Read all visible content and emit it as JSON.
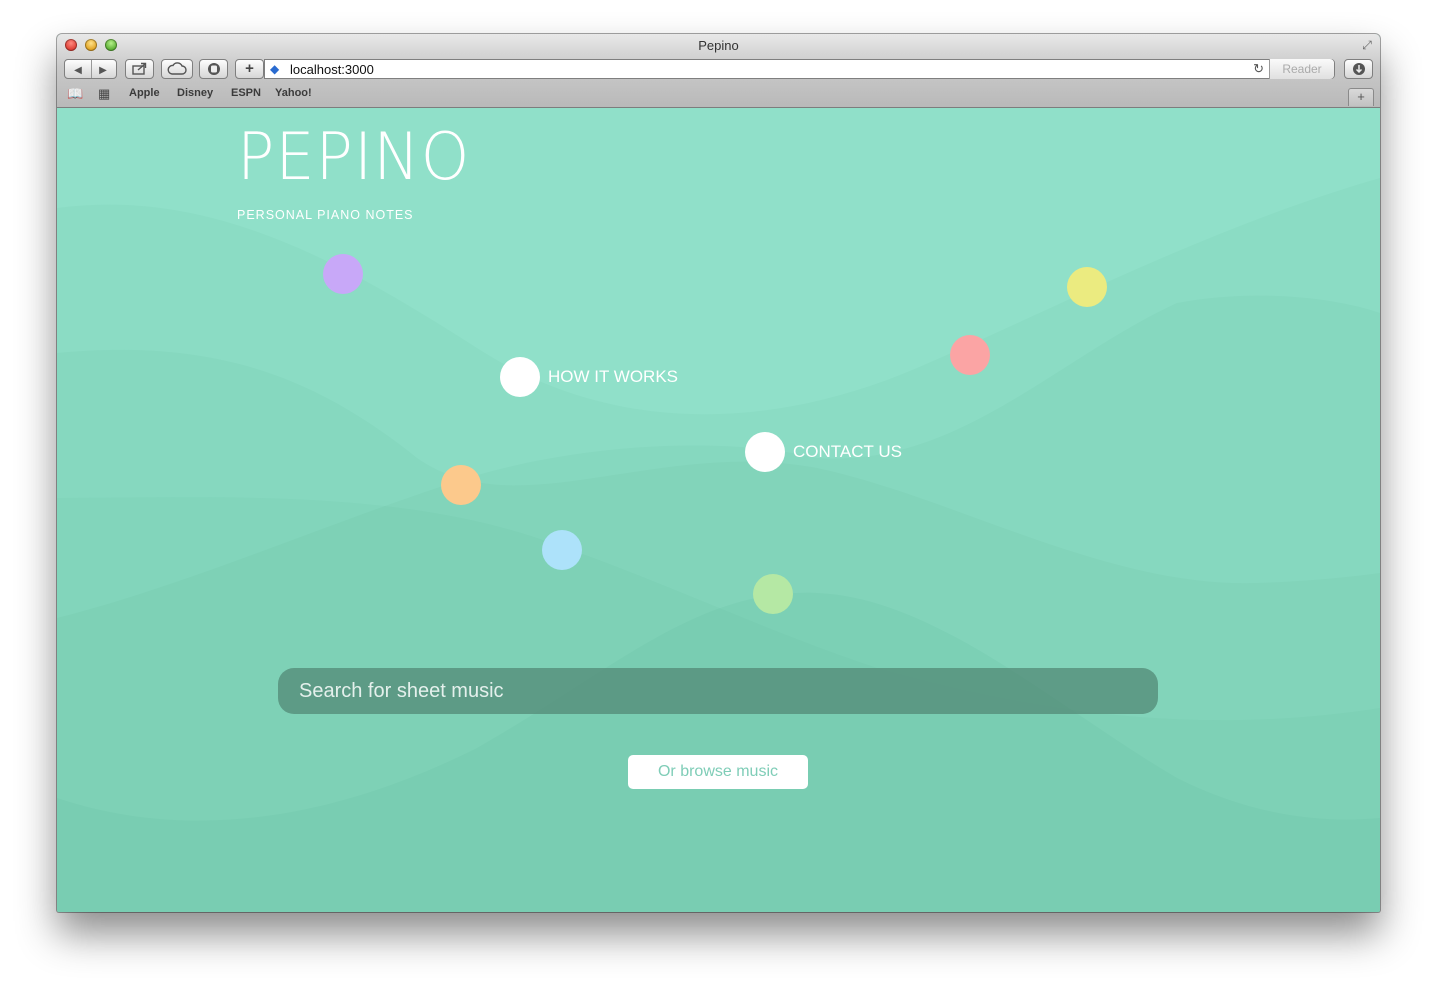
{
  "window": {
    "title": "Pepino"
  },
  "toolbar": {
    "url": "localhost:3000",
    "reader_label": "Reader",
    "back_glyph": "◀",
    "forward_glyph": "▶",
    "add_glyph": "+"
  },
  "bookmarks": [
    {
      "label": "Apple"
    },
    {
      "label": "Disney"
    },
    {
      "label": "ESPN"
    },
    {
      "label": "Yahoo!"
    }
  ],
  "page": {
    "logo": {
      "wordmark": "PEPINO",
      "tagline": "PERSONAL PIANO NOTES"
    },
    "nav": {
      "how_it_works": "HOW IT WORKS",
      "contact_us": "CONTACT US"
    },
    "search": {
      "placeholder": "Search for sheet music",
      "value": ""
    },
    "browse_label": "Or browse music",
    "colors": {
      "background": "#90e0c9",
      "dot_purple": "#c8a8f8",
      "dot_yellow": "#ebeb80",
      "dot_red": "#fba4a4",
      "dot_orange": "#fcc98c",
      "dot_blue": "#ade2fa",
      "dot_green": "#b5e8a4",
      "nav_dot": "#ffffff"
    }
  }
}
